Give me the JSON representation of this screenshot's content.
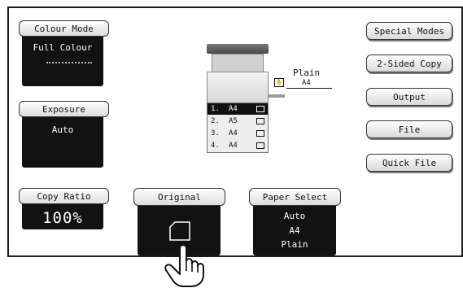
{
  "colour_mode": {
    "label": "Colour Mode",
    "value": "Full Colour"
  },
  "exposure": {
    "label": "Exposure",
    "value": "Auto"
  },
  "copy_ratio": {
    "label": "Copy Ratio",
    "value": "100%"
  },
  "original": {
    "label": "Original"
  },
  "paper_select": {
    "label": "Paper Select",
    "line1": "Auto",
    "line2": "A4",
    "line3": "Plain"
  },
  "bypass_tray": {
    "type": "Plain",
    "size": "A4"
  },
  "trays": [
    {
      "num": "1.",
      "size": "A4",
      "selected": true
    },
    {
      "num": "2.",
      "size": "A5",
      "selected": false
    },
    {
      "num": "3.",
      "size": "A4",
      "selected": false
    },
    {
      "num": "4.",
      "size": "A4",
      "selected": false
    }
  ],
  "right_buttons": {
    "special_modes": "Special Modes",
    "two_sided_copy": "2-Sided Copy",
    "output": "Output",
    "file": "File",
    "quick_file": "Quick File"
  },
  "colors": {
    "dark": "#121212",
    "panel_border": "#1a1a1a"
  }
}
